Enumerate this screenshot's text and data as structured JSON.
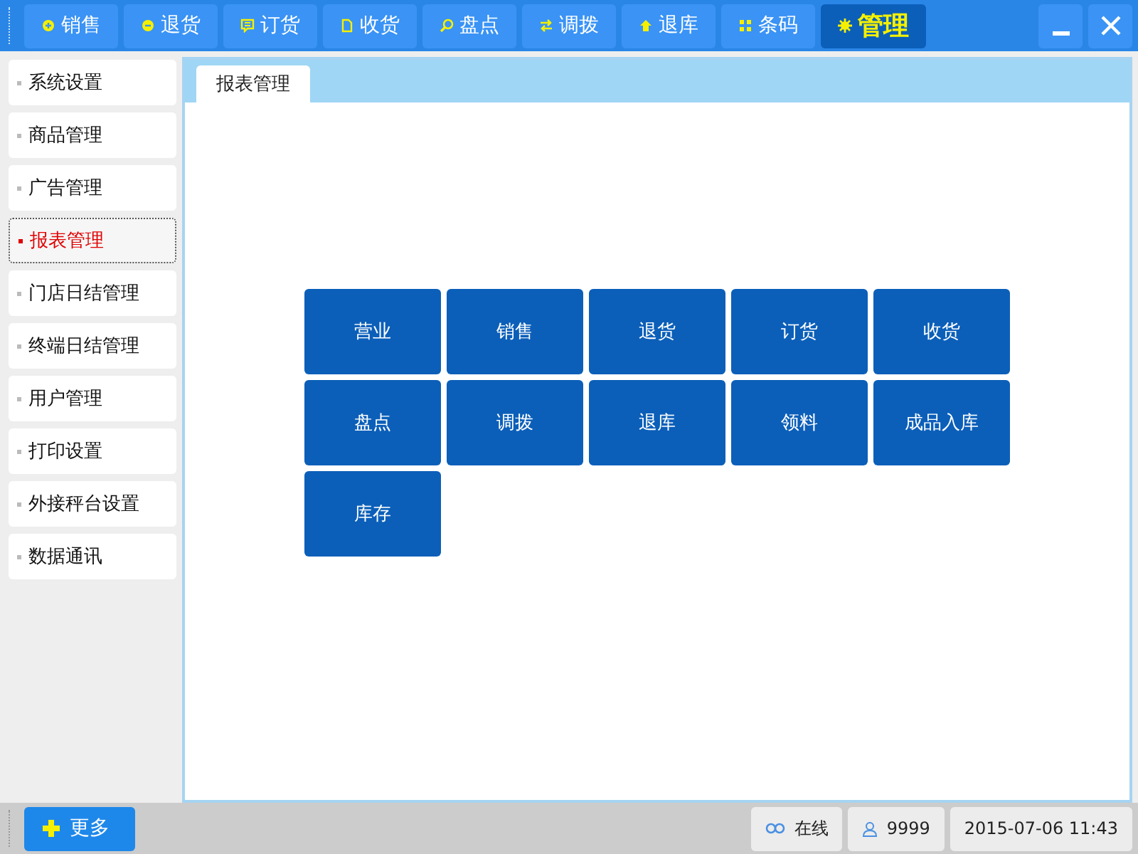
{
  "toolbar": {
    "items": [
      {
        "label": "销售",
        "selected": false
      },
      {
        "label": "退货",
        "selected": false
      },
      {
        "label": "订货",
        "selected": false
      },
      {
        "label": "收货",
        "selected": false
      },
      {
        "label": "盘点",
        "selected": false
      },
      {
        "label": "调拨",
        "selected": false
      },
      {
        "label": "退库",
        "selected": false
      },
      {
        "label": "条码",
        "selected": false
      },
      {
        "label": "管理",
        "selected": true
      }
    ]
  },
  "sidebar": {
    "items": [
      {
        "label": "系统设置",
        "selected": false
      },
      {
        "label": "商品管理",
        "selected": false
      },
      {
        "label": "广告管理",
        "selected": false
      },
      {
        "label": "报表管理",
        "selected": true
      },
      {
        "label": "门店日结管理",
        "selected": false
      },
      {
        "label": "终端日结管理",
        "selected": false
      },
      {
        "label": "用户管理",
        "selected": false
      },
      {
        "label": "打印设置",
        "selected": false
      },
      {
        "label": "外接秤台设置",
        "selected": false
      },
      {
        "label": "数据通讯",
        "selected": false
      }
    ]
  },
  "tabs": [
    {
      "label": "报表管理",
      "selected": true
    }
  ],
  "reports": [
    "营业",
    "销售",
    "退货",
    "订货",
    "收货",
    "盘点",
    "调拨",
    "退库",
    "领料",
    "成品入库",
    "库存"
  ],
  "status_bar": {
    "more": "更多",
    "connection": "在线",
    "user": "9999",
    "datetime": "2015-07-06 11:43"
  }
}
